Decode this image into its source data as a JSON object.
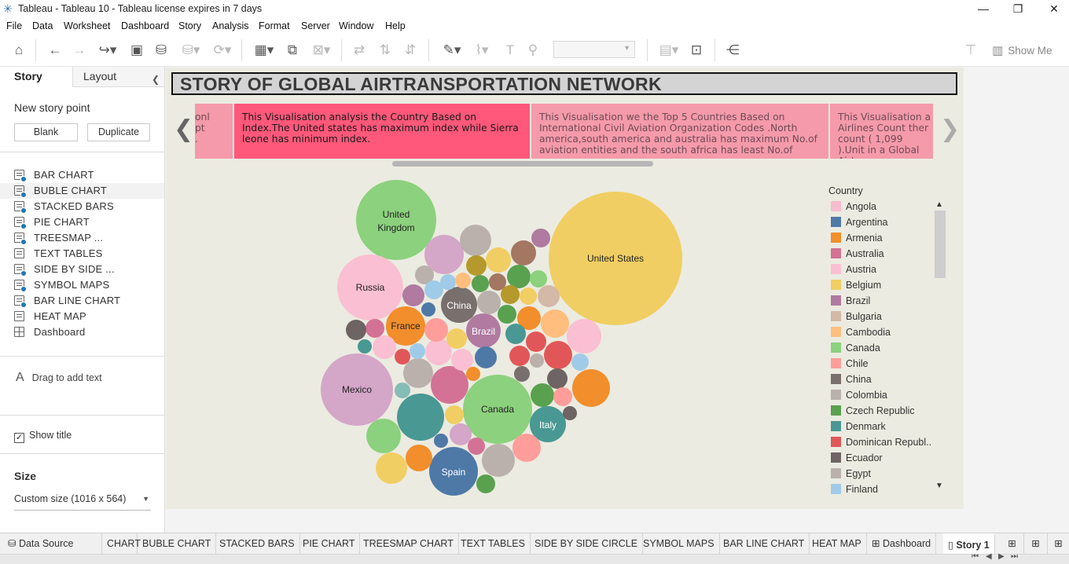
{
  "window": {
    "title": "Tableau - Tableau 10 - Tableau license expires in 7 days",
    "minimize": "—",
    "restore": "❐",
    "close": "✕"
  },
  "menu": [
    "File",
    "Data",
    "Worksheet",
    "Dashboard",
    "Story",
    "Analysis",
    "Format",
    "Server",
    "Window",
    "Help"
  ],
  "toolbar": {
    "show_me": "Show Me"
  },
  "left_panel": {
    "tabs": {
      "story": "Story",
      "layout": "Layout"
    },
    "new_story_point": "New story point",
    "blank_button": "Blank",
    "duplicate_button": "Duplicate",
    "sheets": [
      {
        "label": "BAR CHART",
        "checked": true
      },
      {
        "label": "BUBLE CHART",
        "checked": true
      },
      {
        "label": "STACKED BARS",
        "checked": true
      },
      {
        "label": "PIE CHART",
        "checked": true
      },
      {
        "label": "TREESMAP ...",
        "checked": true
      },
      {
        "label": "TEXT TABLES",
        "checked": false
      },
      {
        "label": "SIDE BY SIDE ...",
        "checked": true
      },
      {
        "label": "SYMBOL MAPS",
        "checked": true
      },
      {
        "label": "BAR LINE CHART",
        "checked": true
      },
      {
        "label": "HEAT MAP",
        "checked": false
      },
      {
        "label": "Dashboard",
        "checked": false,
        "dashboard": true
      }
    ],
    "drag_text": "Drag to add text",
    "show_title": "Show title",
    "size_label": "Size",
    "size_value": "Custom size (1016 x 564)"
  },
  "story": {
    "title": "STORY OF GLOBAL AIRTRANSPORTATION NETWORK",
    "captions": [
      "onl\npt\n.",
      "This Visualisation analysis the Country Based on Index.The United states has maximum index while Sierra leone has minimum index.",
      "This Visualisation we the Top 5 Countries Based on International Civil Aviation Organization  Codes .North america,south america and australia has maximum No.of aviation entities and the south africa has least No.of",
      "This Visualisation a Airlines Count  ther count ( 1,099 ).Unit in a Global Airtrans"
    ]
  },
  "legend": {
    "title": "Country",
    "items": [
      {
        "label": "Angola",
        "color": "#f8bbd0"
      },
      {
        "label": "Argentina",
        "color": "#4e79a7"
      },
      {
        "label": "Armenia",
        "color": "#f28e2b"
      },
      {
        "label": "Australia",
        "color": "#d37295"
      },
      {
        "label": "Austria",
        "color": "#fabfd2"
      },
      {
        "label": "Belgium",
        "color": "#f1ce63"
      },
      {
        "label": "Brazil",
        "color": "#b07aa1"
      },
      {
        "label": "Bulgaria",
        "color": "#d4b8a8"
      },
      {
        "label": "Cambodia",
        "color": "#ffbe7d"
      },
      {
        "label": "Canada",
        "color": "#8cd17d"
      },
      {
        "label": "Chile",
        "color": "#ff9d9a"
      },
      {
        "label": "China",
        "color": "#79706e"
      },
      {
        "label": "Colombia",
        "color": "#bab0ac"
      },
      {
        "label": "Czech Republic",
        "color": "#59a14f"
      },
      {
        "label": "Denmark",
        "color": "#499894"
      },
      {
        "label": "Dominican Republ..",
        "color": "#e15759"
      },
      {
        "label": "Ecuador",
        "color": "#6e6463"
      },
      {
        "label": "Egypt",
        "color": "#bab0ac"
      },
      {
        "label": "Finland",
        "color": "#a0cbe8"
      }
    ]
  },
  "chart_data": {
    "type": "bubble",
    "legend_position": "right",
    "labels": [
      "United Kingdom",
      "Russia",
      "China",
      "France",
      "Brazil",
      "Mexico",
      "Canada",
      "Italy",
      "Spain",
      "United States"
    ]
  },
  "bottom_tabs": [
    "Data Source",
    "CHART",
    "BUBLE CHART",
    "STACKED BARS",
    "PIE CHART",
    "TREESMAP CHART",
    "TEXT TABLES",
    "SIDE BY SIDE CIRCLE",
    "SYMBOL MAPS",
    "BAR LINE CHART",
    "HEAT MAP",
    "Dashboard",
    "Story 1"
  ]
}
